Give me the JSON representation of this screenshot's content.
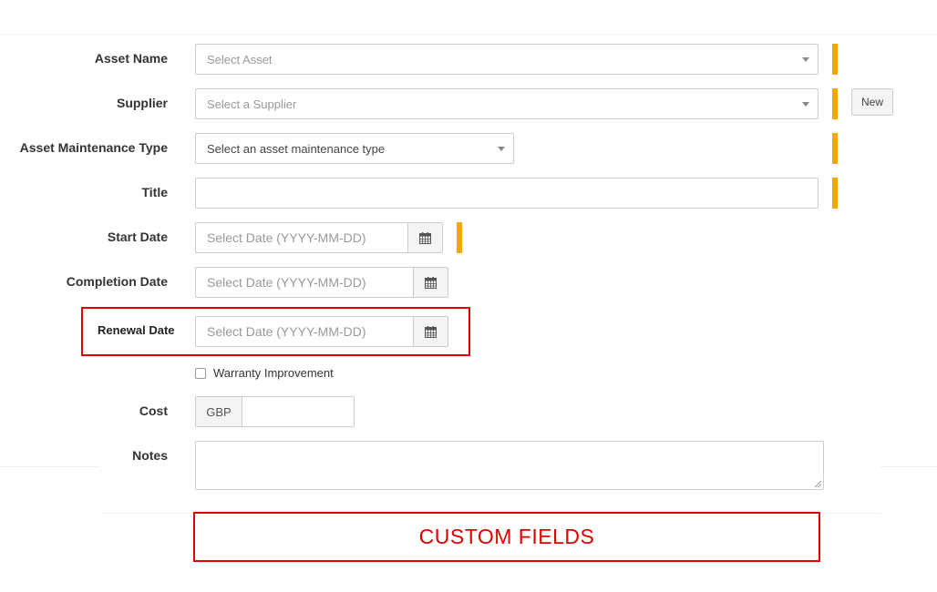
{
  "form": {
    "asset_name": {
      "label": "Asset Name",
      "placeholder": "Select Asset"
    },
    "supplier": {
      "label": "Supplier",
      "placeholder": "Select a Supplier",
      "new_button": "New"
    },
    "maintenance_type": {
      "label": "Asset Maintenance Type",
      "placeholder": "Select an asset maintenance type"
    },
    "title": {
      "label": "Title",
      "value": ""
    },
    "start_date": {
      "label": "Start Date",
      "placeholder": "Select Date (YYYY-MM-DD)"
    },
    "completion_date": {
      "label": "Completion Date",
      "placeholder": "Select Date (YYYY-MM-DD)"
    },
    "renewal_date": {
      "label": "Renewal Date",
      "placeholder": "Select Date (YYYY-MM-DD)"
    },
    "warranty_improvement": {
      "label": "Warranty Improvement",
      "checked": false
    },
    "cost": {
      "label": "Cost",
      "currency": "GBP",
      "value": ""
    },
    "notes": {
      "label": "Notes",
      "value": ""
    }
  },
  "annotation": {
    "custom_fields": "CUSTOM FIELDS"
  },
  "colors": {
    "required_bar": "#f5a800",
    "annotation_red": "#e00000"
  },
  "icons": {
    "calendar": "calendar-icon",
    "dropdown": "chevron-down-icon"
  }
}
